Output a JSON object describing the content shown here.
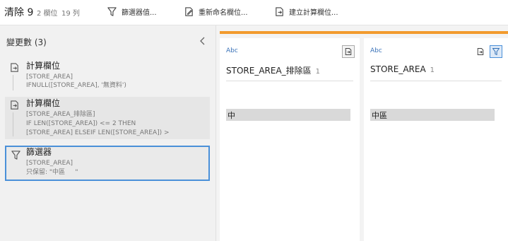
{
  "toolbar": {
    "title": "清除 9",
    "fields": "2 欄位",
    "rows": "19 列",
    "filter_label": "篩選器值...",
    "rename_label": "重新命名欄位...",
    "calc_label": "建立計算欄位..."
  },
  "changes": {
    "title": "變更數 (3)",
    "steps": [
      {
        "title": "計算欄位",
        "lines": [
          "[STORE_AREA]",
          "IFNULL([STORE_AREA], '無資料')"
        ]
      },
      {
        "title": "計算欄位",
        "lines": [
          "[STORE_AREA_排除區]",
          "IF LEN([STORE_AREA]) <= 2 THEN",
          "[STORE_AREA] ELSEIF LEN([STORE_AREA]) >"
        ]
      },
      {
        "title": "篩選器",
        "lines": [
          "[STORE_AREA]",
          "只保留: \"中區     \""
        ]
      }
    ]
  },
  "columns": [
    {
      "type": "Abc",
      "name": "STORE_AREA_排除區",
      "count": "1",
      "value": "中"
    },
    {
      "type": "Abc",
      "name": "STORE_AREA",
      "count": "1",
      "value": "中區"
    }
  ],
  "colors": {
    "accent": "#f29b2e",
    "selection": "#4a90d9",
    "type_label": "#3a72b8"
  }
}
